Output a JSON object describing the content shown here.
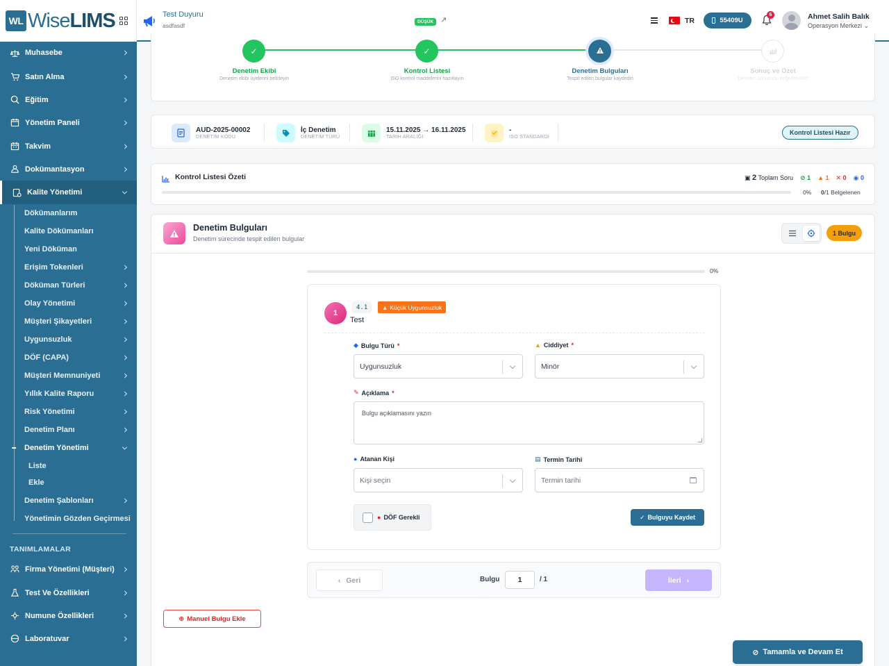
{
  "brand": {
    "wl": "WL",
    "wise": "Wise",
    "lims": "LIMS"
  },
  "announcement": {
    "title": "Test Duyuru",
    "subtitle": "asdfasdf",
    "priority": "DÜŞÜK",
    "link_symbol": "↗"
  },
  "header": {
    "language": "TR",
    "counter": "55409U",
    "notification_count": "6",
    "user_name": "Ahmet Salih Balık",
    "user_role": "Operasyon Merkezi"
  },
  "sidebar": {
    "items": [
      {
        "label": "Muhasebe",
        "icon": "scale-icon"
      },
      {
        "label": "Satın Alma",
        "icon": "cart-icon"
      },
      {
        "label": "Eğitim",
        "icon": "search-icon"
      },
      {
        "label": "Yönetim Paneli",
        "icon": "calendar-icon"
      },
      {
        "label": "Takvim",
        "icon": "calendar-icon"
      },
      {
        "label": "Dokümantasyon",
        "icon": "docs-icon"
      },
      {
        "label": "Kalite Yönetimi",
        "icon": "quality-icon",
        "active": true
      }
    ],
    "sub_items": [
      {
        "label": "Dökümanlarım",
        "chevron": false
      },
      {
        "label": "Kalite Dökümanları",
        "chevron": false
      },
      {
        "label": "Yeni Döküman",
        "chevron": false
      },
      {
        "label": "Erişim Tokenleri",
        "chevron": true
      },
      {
        "label": "Döküman Türleri",
        "chevron": true
      },
      {
        "label": "Olay Yönetimi",
        "chevron": true
      },
      {
        "label": "Müşteri Şikayetleri",
        "chevron": true
      },
      {
        "label": "Uygunsuzluk",
        "chevron": true
      },
      {
        "label": "DÖF (CAPA)",
        "chevron": true
      },
      {
        "label": "Müşteri Memnuniyeti",
        "chevron": true
      },
      {
        "label": "Yıllık Kalite Raporu",
        "chevron": true
      },
      {
        "label": "Risk Yönetimi",
        "chevron": true
      },
      {
        "label": "Denetim Planı",
        "chevron": true
      },
      {
        "label": "Denetim Yönetimi",
        "chevron": true,
        "expanded": true
      }
    ],
    "subsub_items": [
      "Liste",
      "Ekle"
    ],
    "sub_items_after": [
      {
        "label": "Denetim Şablonları",
        "chevron": true
      },
      {
        "label": "Yönetimin Gözden Geçirmesi",
        "chevron": false
      }
    ],
    "section_title": "TANIMLAMALAR",
    "definition_items": [
      {
        "label": "Firma Yönetimi (Müşteri)",
        "icon": "company-icon"
      },
      {
        "label": "Test Ve Özellikleri",
        "icon": "flask-icon"
      },
      {
        "label": "Numune Özellikleri",
        "icon": "sample-icon"
      },
      {
        "label": "Laboratuvar",
        "icon": "lab-icon"
      }
    ]
  },
  "stepper": {
    "steps": [
      {
        "title": "Denetim Ekibi",
        "desc": "Denetim ekibi üyelerini belirleyin",
        "state": "done"
      },
      {
        "title": "Kontrol Listesi",
        "desc": "ISO kontrol maddelerini hazırlayın",
        "state": "done"
      },
      {
        "title": "Denetim Bulguları",
        "desc": "Tespit edilen bulgular kaydedin",
        "state": "current"
      },
      {
        "title": "Sonuç ve Özet",
        "desc": "Denetim sonucunu değerlendirin",
        "state": "pending"
      }
    ],
    "check_symbol": "✓",
    "warn_symbol": "!"
  },
  "info": {
    "code": "AUD-2025-00002",
    "code_label": "DENETİM KODU",
    "type": "İç Denetim",
    "type_label": "DENETİM TÜRÜ",
    "dates": "15.11.2025 → 16.11.2025",
    "dates_label": "TARİH ARALIĞI",
    "standard": "-",
    "standard_label": "ISO STANDARDI",
    "status": "Kontrol Listesi Hazır"
  },
  "summary": {
    "title": "Kontrol Listesi Özeti",
    "total": "2",
    "total_label": "Toplam Soru",
    "ok": "1",
    "warn": "1",
    "fail": "0",
    "view": "0",
    "percent": "0%",
    "docs_done": "0",
    "docs_total": "/1 Belgelenen"
  },
  "findings": {
    "title": "Denetim Bulguları",
    "subtitle": "Denetim sürecinde tespit edilen bulgular",
    "count_badge": "1 Bulgu",
    "progress_pct": "0%",
    "progress_value": 0,
    "item": {
      "number": "1",
      "code": "4.1",
      "severity": "Küçük Uygunsuzluk",
      "text": "Test",
      "type_label": "Bulgu Türü",
      "type_value": "Uygunsuzluk",
      "severity_label": "Ciddiyet",
      "severity_value": "Minör",
      "desc_label": "Açıklama",
      "desc_placeholder": "Bulgu açıklamasını yazın",
      "assignee_label": "Atanan Kişi",
      "assignee_placeholder": "Kişi seçin",
      "due_label": "Termin Tarihi",
      "due_placeholder": "Termin tarihi",
      "capa_label": "DÖF Gerekli",
      "save_label": "Bulguyu Kaydet",
      "required_mark": "*"
    },
    "pager": {
      "prev": "Geri",
      "label": "Bulgu",
      "current": "1",
      "total": "/ 1",
      "next": "İleri"
    },
    "manual_add": "Manuel Bulgu Ekle"
  },
  "finish_label": "Tamamla ve Devam Et",
  "colors": {
    "brand": "#2a6f93",
    "success": "#22c55e",
    "current_step": "#2a6f93",
    "warning": "#f59e0b",
    "danger": "#dc2626",
    "accent_pink": "#ec4899"
  }
}
